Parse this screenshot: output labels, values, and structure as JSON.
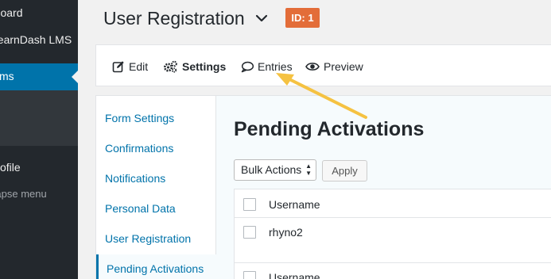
{
  "sidebar": {
    "dashboard": "Dashboard",
    "learndash": "LearnDash LMS",
    "forms": "Forms",
    "profile": "Profile",
    "collapse": "Collapse menu"
  },
  "header": {
    "title": "User Registration",
    "chevron_icon": "chevron-down-icon",
    "id_badge": "ID: 1",
    "badge_color": "#e36d39"
  },
  "tabs": [
    {
      "label": "Edit",
      "icon": "edit-icon"
    },
    {
      "label": "Settings",
      "icon": "gears-icon"
    },
    {
      "label": "Entries",
      "icon": "speech-bubble-icon"
    },
    {
      "label": "Preview",
      "icon": "eye-icon"
    }
  ],
  "settings_nav": [
    {
      "label": "Form Settings"
    },
    {
      "label": "Confirmations"
    },
    {
      "label": "Notifications"
    },
    {
      "label": "Personal Data"
    },
    {
      "label": "User Registration"
    },
    {
      "label": "Pending Activations",
      "active": true
    }
  ],
  "content": {
    "title": "Pending Activations",
    "bulk_actions": "Bulk Actions",
    "apply": "Apply",
    "table": {
      "header": "Username",
      "rows": [
        {
          "username": "rhyno2"
        }
      ],
      "footer": "Username"
    }
  },
  "colors": {
    "accent": "#0073aa",
    "sidebar_bg": "#23282d",
    "annotation_arrow": "#f5c242"
  }
}
